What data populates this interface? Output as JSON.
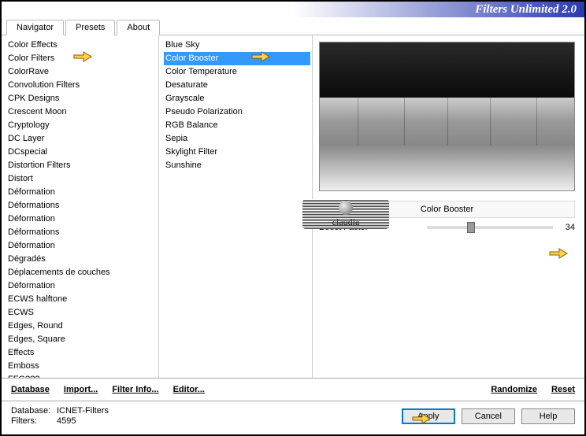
{
  "header": {
    "title": "Filters Unlimited 2.0"
  },
  "tabs": [
    {
      "label": "Navigator",
      "active": true
    },
    {
      "label": "Presets",
      "active": false
    },
    {
      "label": "About",
      "active": false
    }
  ],
  "categories": {
    "items": [
      "Color Effects",
      "Color Filters",
      "ColorRave",
      "Convolution Filters",
      "CPK Designs",
      "Crescent Moon",
      "Cryptology",
      "DC Layer",
      "DCspecial",
      "Distortion Filters",
      "Distort",
      "Déformation",
      "Déformations",
      "Déformation",
      "Déformations",
      "Déformation",
      "Dégradés",
      "Déplacements de couches",
      "Déformation",
      "ECWS halftone",
      "ECWS",
      "Edges, Round",
      "Edges, Square",
      "Effects",
      "Emboss",
      "FFG???"
    ],
    "highlighted_index": 1
  },
  "filters": {
    "items": [
      "Blue Sky",
      "Color Booster",
      "Color Temperature",
      "Desaturate",
      "Grayscale",
      "Pseudo Polarization",
      "RGB Balance",
      "Sepia",
      "Skylight Filter",
      "Sunshine"
    ],
    "selected_index": 1
  },
  "params": {
    "title": "Color Booster",
    "boost_factor": {
      "label": "Boost Factor",
      "value": 34,
      "min": 0,
      "max": 100
    }
  },
  "toolbar": {
    "database": "Database",
    "import": "Import...",
    "filter_info": "Filter Info...",
    "editor": "Editor...",
    "randomize": "Randomize",
    "reset": "Reset"
  },
  "footer": {
    "database_label": "Database:",
    "database_value": "ICNET-Filters",
    "filters_label": "Filters:",
    "filters_value": "4595",
    "apply": "Apply",
    "cancel": "Cancel",
    "help": "Help"
  },
  "watermark": {
    "text": "claudia"
  }
}
